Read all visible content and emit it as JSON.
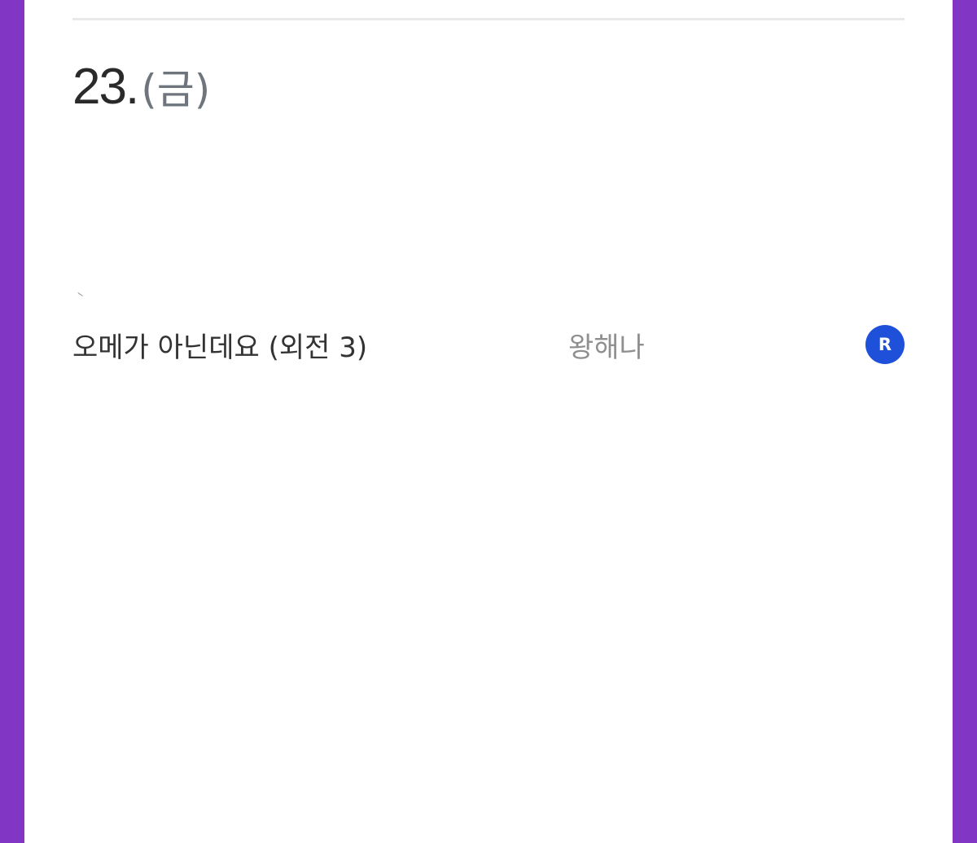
{
  "colors": {
    "background": "#8236c4",
    "panel": "#ffffff",
    "badge": "#1f50d9"
  },
  "date": {
    "day": "23.",
    "weekday": "(금)"
  },
  "entry": {
    "title": "오메가 아닌데요 (외전 3)",
    "author": "왕해나",
    "badge_icon": "r-badge-icon",
    "badge_label": "R"
  }
}
